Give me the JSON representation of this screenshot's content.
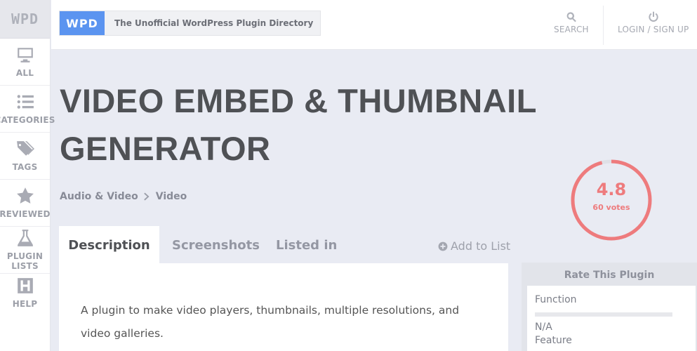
{
  "sidebar": {
    "logo": "WPD",
    "items": [
      {
        "label": "ALL",
        "icon": "monitor-icon"
      },
      {
        "label": "CATEGORIES",
        "icon": "list-icon"
      },
      {
        "label": "TAGS",
        "icon": "tags-icon"
      },
      {
        "label": "REVIEWED",
        "icon": "star-icon"
      },
      {
        "label": "PLUGIN LISTS",
        "icon": "flask-icon"
      },
      {
        "label": "HELP",
        "icon": "help-icon"
      }
    ]
  },
  "header": {
    "brand_badge": "WPD",
    "brand_text": "The Unofficial WordPress Plugin Directory",
    "search_label": "SEARCH",
    "login_label": "LOGIN / SIGN UP"
  },
  "plugin": {
    "title": "VIDEO EMBED & THUMBNAIL GENERATOR",
    "breadcrumb": [
      "Audio & Video",
      "Video"
    ],
    "rating": {
      "value": "4.8",
      "votes": "60 votes",
      "fraction": 0.96,
      "color": "#ee7b7d"
    }
  },
  "tabs": [
    {
      "label": "Description",
      "active": true
    },
    {
      "label": "Screenshots",
      "active": false
    },
    {
      "label": "Listed in",
      "active": false
    }
  ],
  "add_to_list": "Add to List",
  "description": "A plugin to make video players, thumbnails, multiple resolutions, and video galleries.",
  "rate_panel": {
    "title": "Rate This Plugin",
    "criteria_label": "Function",
    "value": "N/A",
    "next_label": "Feature"
  }
}
